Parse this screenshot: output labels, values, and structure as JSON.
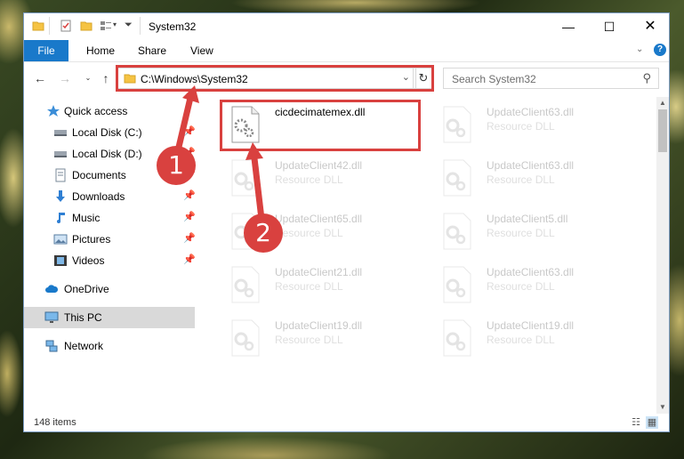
{
  "window": {
    "title": "System32"
  },
  "ribbon": {
    "tabs": [
      "File",
      "Home",
      "Share",
      "View"
    ]
  },
  "address": {
    "path": "C:\\Windows\\System32",
    "search_placeholder": "Search System32"
  },
  "nav": {
    "items": [
      {
        "label": "Quick access",
        "icon": "star-icon"
      },
      {
        "label": "Local Disk (C:)",
        "icon": "drive-icon"
      },
      {
        "label": "Local Disk (D:)",
        "icon": "drive-icon"
      },
      {
        "label": "Documents",
        "icon": "documents-icon"
      },
      {
        "label": "Downloads",
        "icon": "download-icon"
      },
      {
        "label": "Music",
        "icon": "music-icon"
      },
      {
        "label": "Pictures",
        "icon": "pictures-icon"
      },
      {
        "label": "Videos",
        "icon": "videos-icon"
      },
      {
        "label": "OneDrive",
        "icon": "cloud-icon"
      },
      {
        "label": "This PC",
        "icon": "computer-icon"
      },
      {
        "label": "Network",
        "icon": "network-icon"
      }
    ]
  },
  "files": [
    {
      "name": "cicdecimatemex.dll",
      "type": ""
    },
    {
      "name": "UpdateClient63.dll",
      "type": "Resource DLL"
    },
    {
      "name": "UpdateClient42.dll",
      "type": "Resource DLL"
    },
    {
      "name": "UpdateClient63.dll",
      "type": "Resource DLL"
    },
    {
      "name": "UpdateClient65.dll",
      "type": "Resource DLL"
    },
    {
      "name": "UpdateClient5.dll",
      "type": "Resource DLL"
    },
    {
      "name": "UpdateClient21.dll",
      "type": "Resource DLL"
    },
    {
      "name": "UpdateClient63.dll",
      "type": "Resource DLL"
    },
    {
      "name": "UpdateClient19.dll",
      "type": "Resource DLL"
    },
    {
      "name": "UpdateClient19.dll",
      "type": "Resource DLL"
    }
  ],
  "status": {
    "item_count": "148 items"
  },
  "callouts": [
    "1",
    "2"
  ],
  "colors": {
    "accent": "#1979ca",
    "highlight": "#d9413f",
    "selected_nav": "#d9d9d9"
  }
}
